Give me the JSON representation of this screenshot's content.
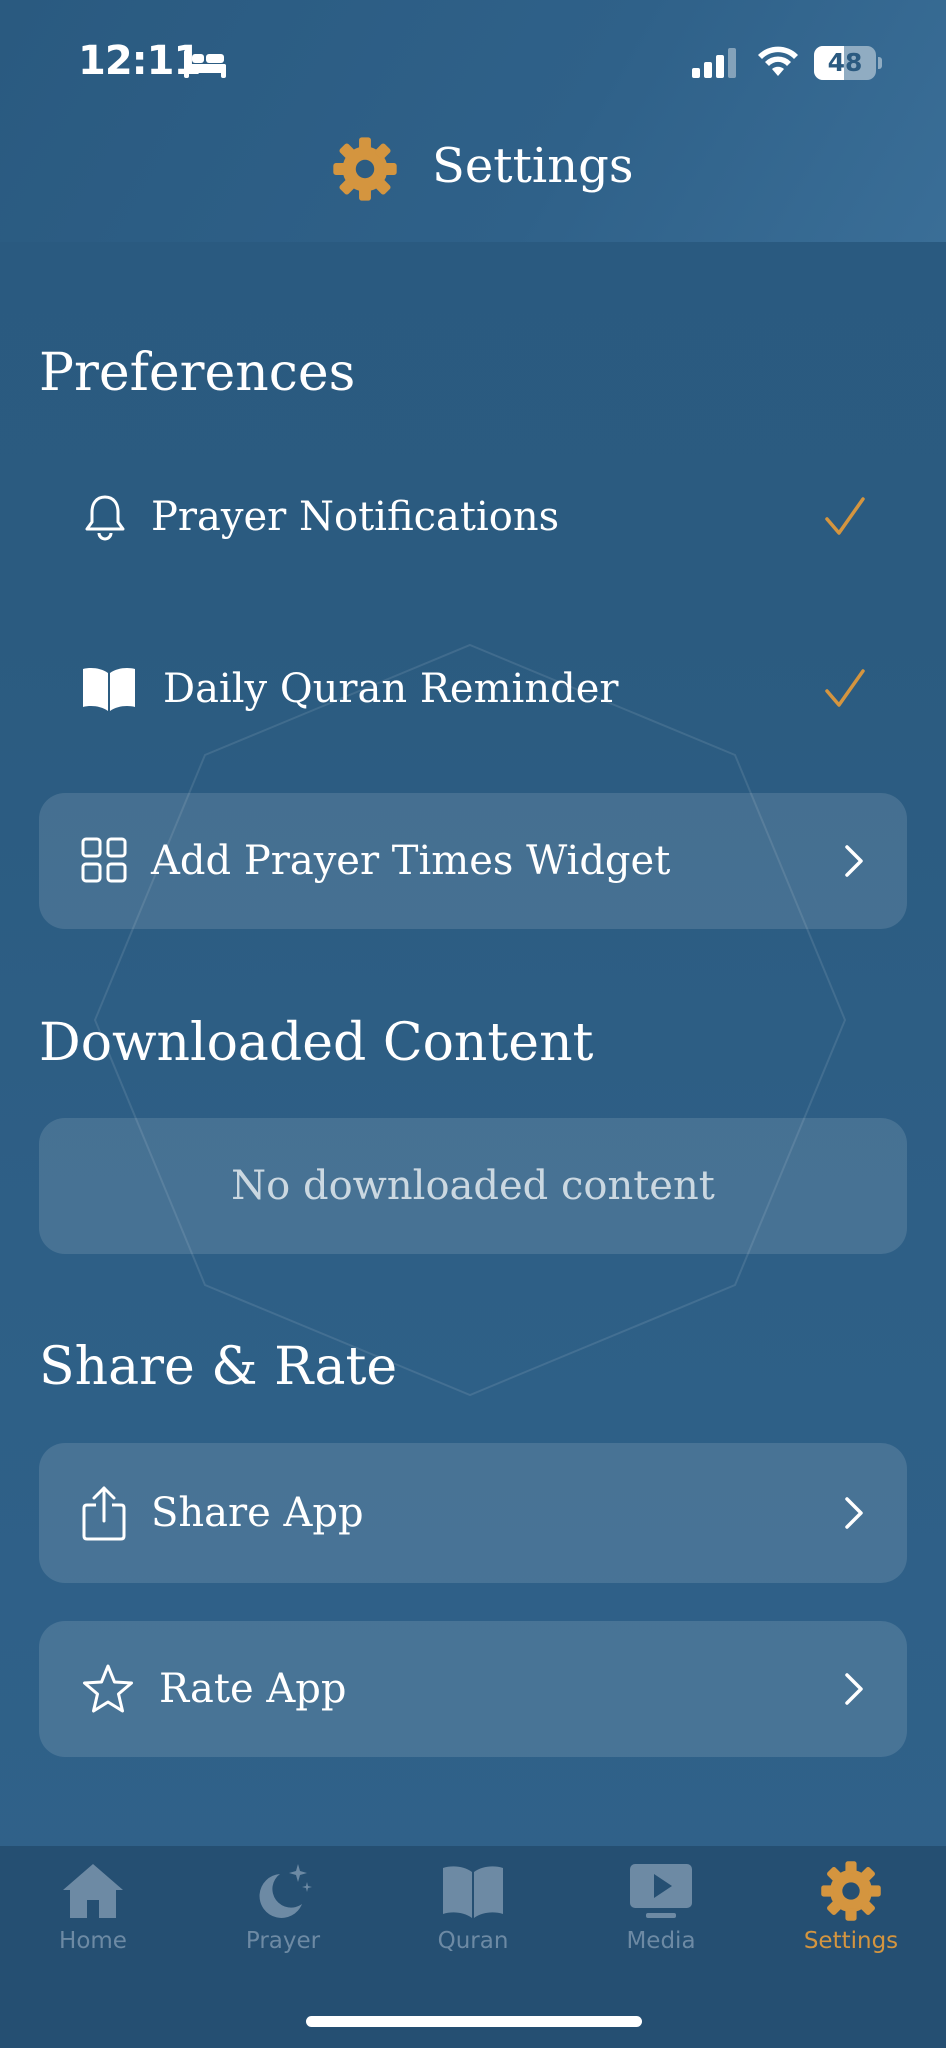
{
  "status_bar": {
    "time": "12:11",
    "battery_level": "48",
    "battery_fraction": 0.48,
    "icons": [
      "bed-icon",
      "cellular-signal-icon",
      "wifi-icon",
      "battery-icon"
    ]
  },
  "header": {
    "title": "Settings",
    "icon": "gear-icon"
  },
  "preferences": {
    "heading": "Preferences",
    "items": [
      {
        "label": "Prayer Notifications",
        "icon": "bell-icon",
        "state": "checked"
      },
      {
        "label": "Daily Quran Reminder",
        "icon": "open-book-icon",
        "state": "checked"
      },
      {
        "label": "Add Prayer Times Widget",
        "icon": "grid-icon",
        "state": "chevron"
      }
    ]
  },
  "downloaded": {
    "heading": "Downloaded Content",
    "empty_message": "No downloaded content"
  },
  "share_rate": {
    "heading": "Share & Rate",
    "items": [
      {
        "label": "Share App",
        "icon": "share-icon"
      },
      {
        "label": "Rate App",
        "icon": "star-icon"
      }
    ]
  },
  "tab_bar": {
    "tabs": [
      {
        "label": "Home",
        "icon": "house-icon",
        "active": false
      },
      {
        "label": "Prayer",
        "icon": "moon-stars-icon",
        "active": false
      },
      {
        "label": "Quran",
        "icon": "book-icon",
        "active": false
      },
      {
        "label": "Media",
        "icon": "play-tv-icon",
        "active": false
      },
      {
        "label": "Settings",
        "icon": "gear-icon",
        "active": true
      }
    ]
  },
  "colors": {
    "accent": "#d4953f",
    "background": "#2b5b80",
    "card": "#46739a",
    "tab_inactive": "#6d8aa4"
  }
}
